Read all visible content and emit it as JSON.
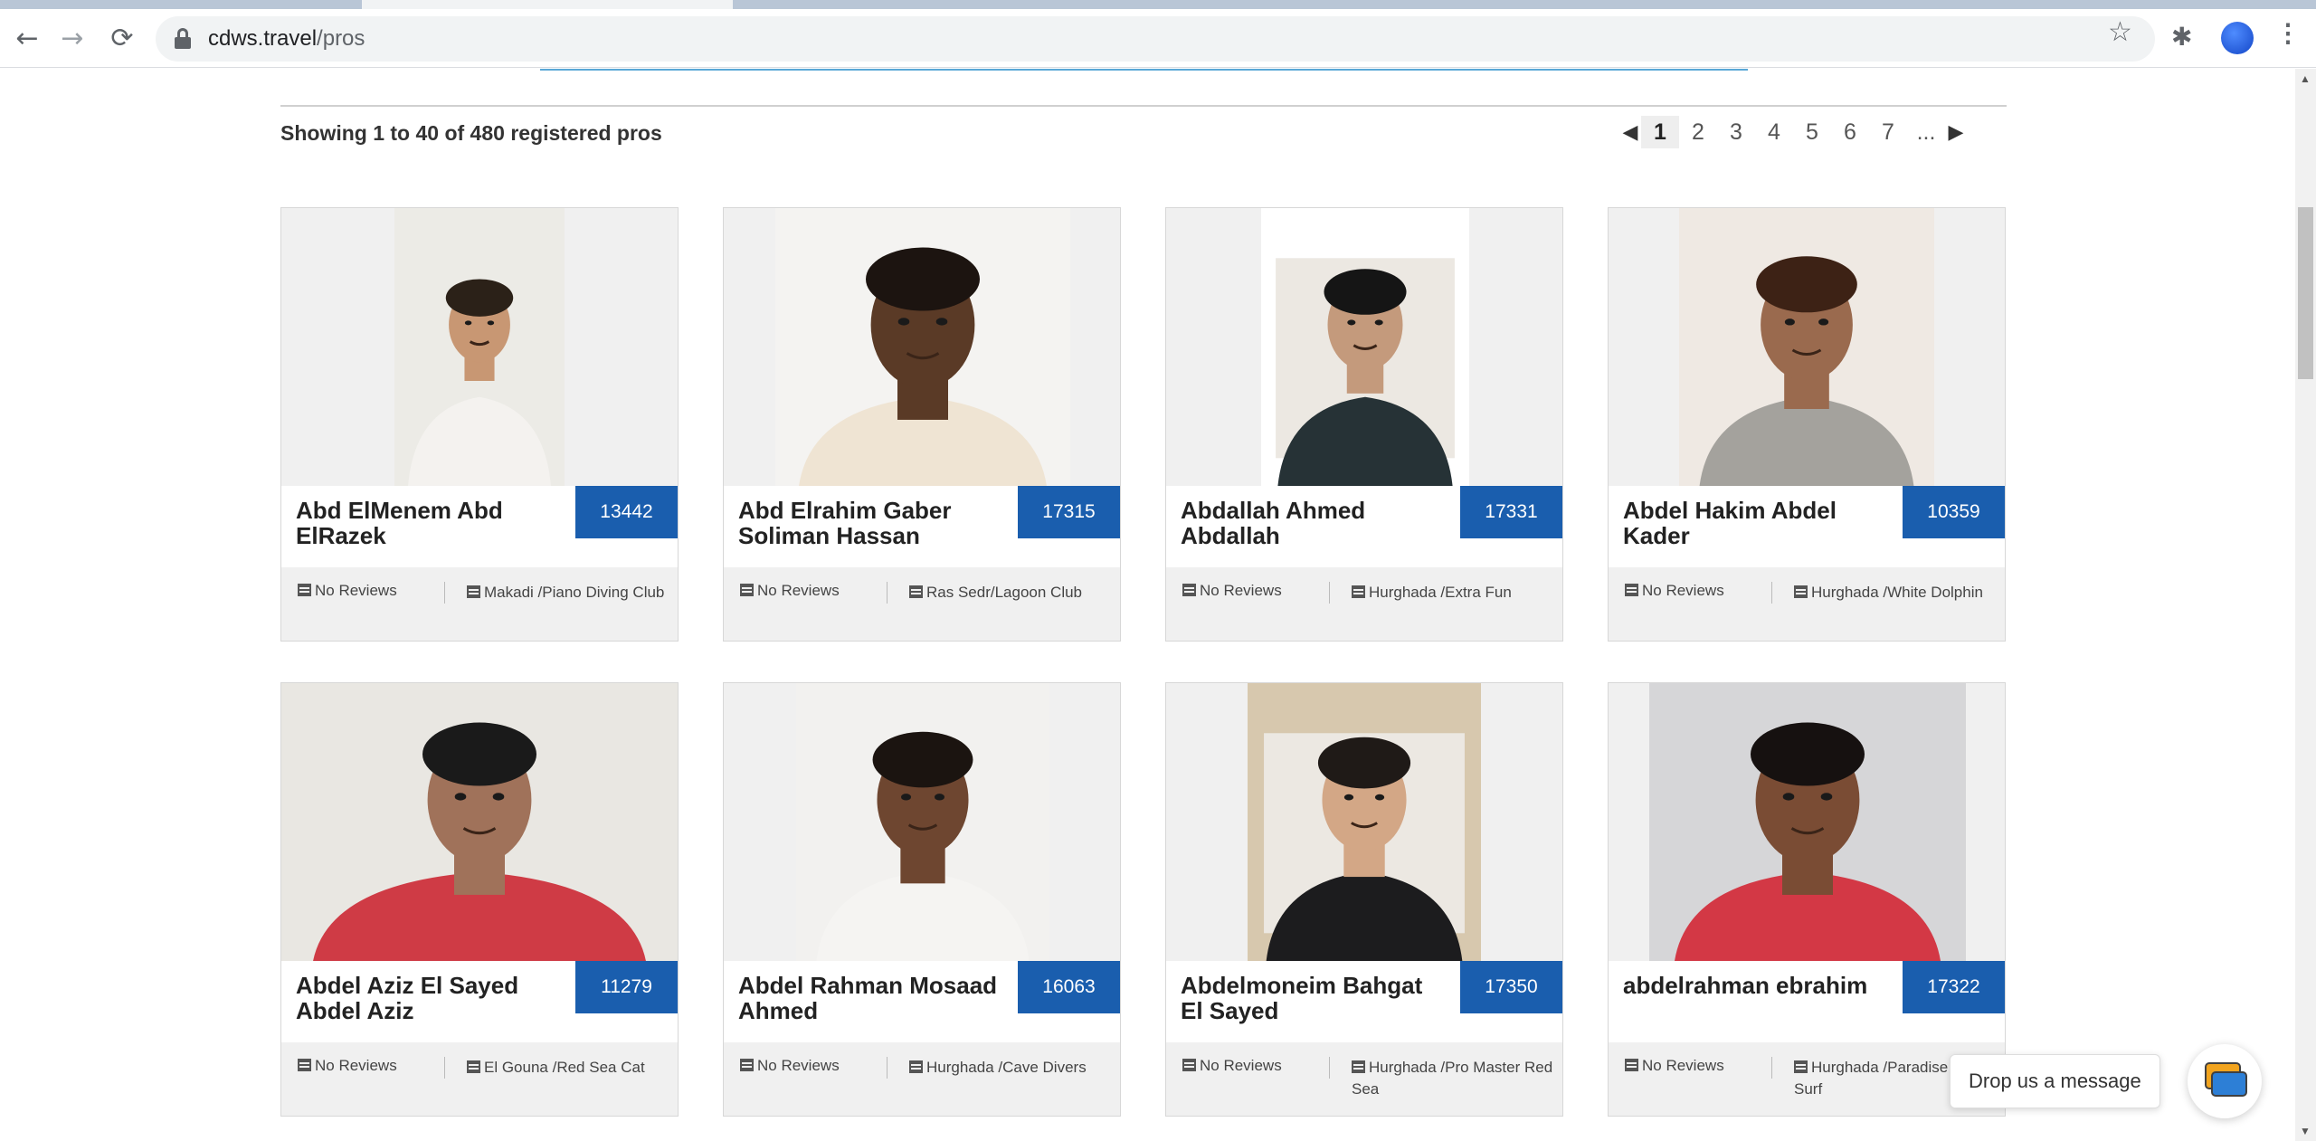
{
  "browser": {
    "url_host": "cdws.travel",
    "url_path": "/pros"
  },
  "listing": {
    "showing_text": "Showing 1 to 40 of 480 registered pros",
    "pages": [
      "1",
      "2",
      "3",
      "4",
      "5",
      "6",
      "7",
      "..."
    ],
    "current_page": "1"
  },
  "pros": [
    {
      "name": "Abd ElMenem Abd ElRazek",
      "id": "13442",
      "reviews": "No Reviews",
      "location": "Makadi /Piano Diving Club"
    },
    {
      "name": "Abd Elrahim Gaber Soliman Hassan",
      "id": "17315",
      "reviews": "No Reviews",
      "location": "Ras Sedr/Lagoon Club"
    },
    {
      "name": "Abdallah Ahmed Abdallah",
      "id": "17331",
      "reviews": "No Reviews",
      "location": "Hurghada /Extra Fun"
    },
    {
      "name": "Abdel Hakim Abdel Kader",
      "id": "10359",
      "reviews": "No Reviews",
      "location": "Hurghada /White Dolphin"
    },
    {
      "name": "Abdel Aziz El Sayed Abdel Aziz",
      "id": "11279",
      "reviews": "No Reviews",
      "location": "El Gouna /Red Sea Cat"
    },
    {
      "name": "Abdel Rahman Mosaad Ahmed",
      "id": "16063",
      "reviews": "No Reviews",
      "location": "Hurghada /Cave Divers"
    },
    {
      "name": "Abdelmoneim Bahgat El Sayed",
      "id": "17350",
      "reviews": "No Reviews",
      "location": "Hurghada /Pro Master Red Sea"
    },
    {
      "name": "abdelrahman ebrahim",
      "id": "17322",
      "reviews": "No Reviews",
      "location": "Hurghada /Paradise Kite Surf"
    }
  ],
  "chat": {
    "label": "Drop us a message"
  },
  "colors": {
    "id_badge": "#1a5eae",
    "accent_line": "#5aa7d6"
  }
}
